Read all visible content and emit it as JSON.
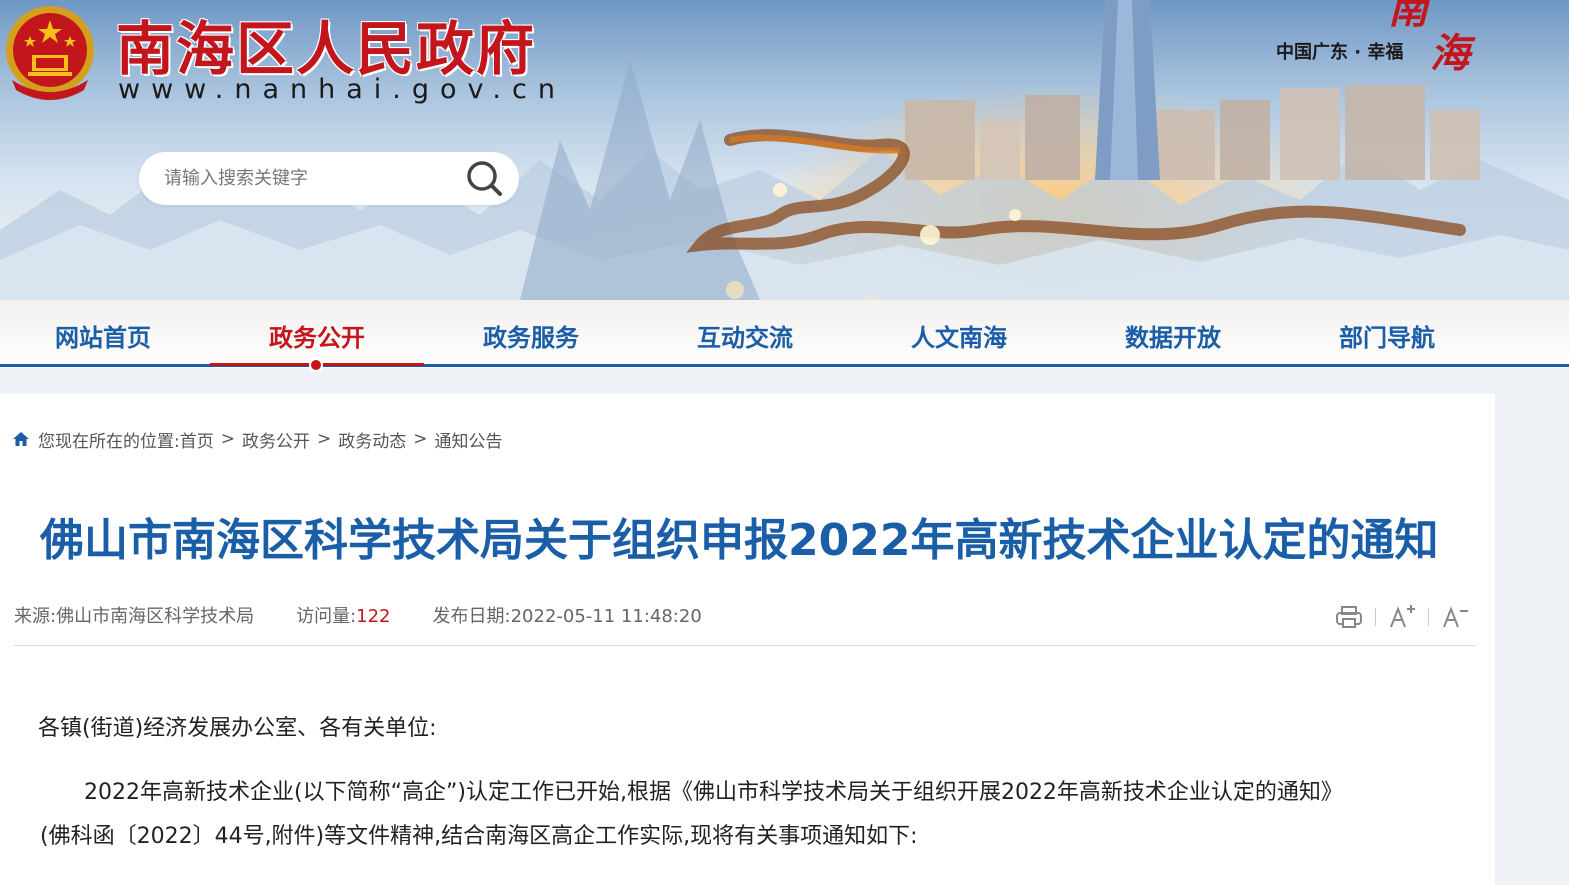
{
  "header": {
    "site_name": "南海区人民政府",
    "site_url": "www.nanhai.gov.cn",
    "slogan": "中国广东 · 幸福",
    "calligraphy": [
      "南",
      "海"
    ]
  },
  "search": {
    "placeholder": "请输入搜索关键字"
  },
  "nav": {
    "items": [
      {
        "label": "网站首页"
      },
      {
        "label": "政务公开",
        "active": true
      },
      {
        "label": "政务服务"
      },
      {
        "label": "互动交流"
      },
      {
        "label": "人文南海"
      },
      {
        "label": "数据开放"
      },
      {
        "label": "部门导航"
      }
    ]
  },
  "breadcrumb": {
    "prefix": "您现在所在的位置:",
    "items": [
      "首页",
      "政务公开",
      "政务动态",
      "通知公告"
    ],
    "separator": ">"
  },
  "article": {
    "title": "佛山市南海区科学技术局关于组织申报2022年高新技术企业认定的通知",
    "meta": {
      "source_label": "来源:",
      "source": "佛山市南海区科学技术局",
      "visits_label": "访问量:",
      "visits": "122",
      "date_label": "发布日期:",
      "date": "2022-05-11 11:48:20"
    },
    "tools": [
      "print-icon",
      "font-increase-icon",
      "font-decrease-icon"
    ],
    "paragraphs": [
      "各镇(街道)经济发展办公室、各有关单位:",
      "2022年高新技术企业(以下简称“高企”)认定工作已开始,根据《佛山市科学技术局关于组织开展2022年高新技术企业认定的通知》",
      "(佛科函〔2022〕44号,附件)等文件精神,结合南海区高企工作实际,现将有关事项通知如下:"
    ]
  },
  "colors": {
    "brand_red": "#c3161c",
    "brand_blue": "#1b5ea8"
  }
}
